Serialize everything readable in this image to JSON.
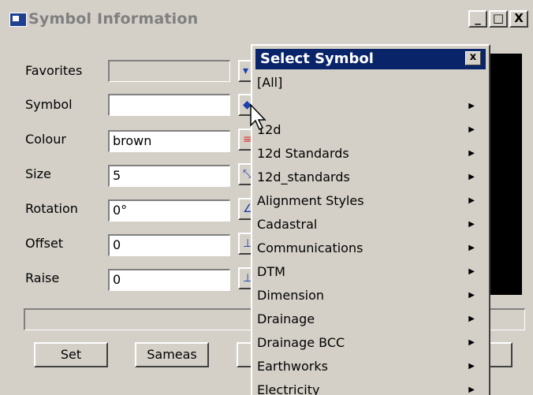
{
  "window": {
    "title": "Symbol Information",
    "controls": {
      "minimize": "_",
      "maximize": "□",
      "close": "X"
    }
  },
  "fields": {
    "favorites": {
      "label": "Favorites",
      "value": ""
    },
    "symbol": {
      "label": "Symbol",
      "value": ""
    },
    "colour": {
      "label": "Colour",
      "value": "brown"
    },
    "size": {
      "label": "Size",
      "value": "5"
    },
    "rotation": {
      "label": "Rotation",
      "value": "0°"
    },
    "offset": {
      "label": "Offset",
      "value": "0"
    },
    "raise": {
      "label": "Raise",
      "value": "0"
    }
  },
  "buttons": {
    "set": "Set",
    "sameas": "Sameas"
  },
  "popup": {
    "title": "Select Symbol",
    "close": "x",
    "items": [
      {
        "label": "[All]",
        "submenu": false
      },
      {
        "label": "",
        "submenu": true
      },
      {
        "label": "12d",
        "submenu": true
      },
      {
        "label": "12d Standards",
        "submenu": true
      },
      {
        "label": "12d_standards",
        "submenu": true
      },
      {
        "label": "Alignment Styles",
        "submenu": true
      },
      {
        "label": "Cadastral",
        "submenu": true
      },
      {
        "label": "Communications",
        "submenu": true
      },
      {
        "label": "DTM",
        "submenu": true
      },
      {
        "label": "Dimension",
        "submenu": true
      },
      {
        "label": "Drainage",
        "submenu": true
      },
      {
        "label": "Drainage BCC",
        "submenu": true
      },
      {
        "label": "Earthworks",
        "submenu": true
      },
      {
        "label": "Electricity",
        "submenu": true
      }
    ]
  },
  "colors": {
    "title_active": "#0a246a",
    "dialog_bg": "#d4d0c8",
    "preview_bg": "#000000"
  }
}
